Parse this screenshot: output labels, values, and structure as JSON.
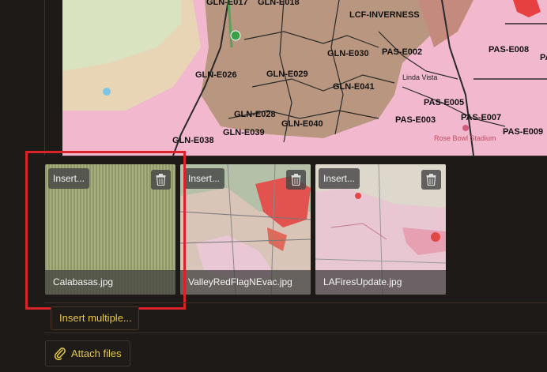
{
  "map": {
    "labels": {
      "gln_e017": "GLN-E017",
      "gln_e018": "GLN-E018",
      "lcf_inverness": "LCF-INVERNESS",
      "gln_e030": "GLN-E030",
      "pas_e002": "PAS-E002",
      "pas_e008": "PAS-E008",
      "gln_e026": "GLN-E026",
      "gln_e029": "GLN-E029",
      "gln_e041": "GLN-E041",
      "linda_vista": "Linda Vista",
      "pas_e005": "PAS-E005",
      "gln_e028": "GLN-E028",
      "pas_e003": "PAS-E003",
      "pas_e007": "PAS-E007",
      "gln_e039": "GLN-E039",
      "gln_e040": "GLN-E040",
      "pas_e009": "PAS-E009",
      "gln_e038": "GLN-E038",
      "rose_bowl": "Rose Bowl Stadium",
      "pas_partial": "PAS-"
    }
  },
  "attachments": [
    {
      "insert_label": "Insert...",
      "filename": "Calabasas.jpg"
    },
    {
      "insert_label": "Insert...",
      "filename": "ValleyRedFlagNEvac.jpg"
    },
    {
      "insert_label": "Insert...",
      "filename": "LAFiresUpdate.jpg"
    }
  ],
  "actions": {
    "insert_multiple": "Insert multiple...",
    "attach_files": "Attach files"
  },
  "colors": {
    "accent_text": "#e6c84b",
    "highlight": "#d8232a"
  }
}
